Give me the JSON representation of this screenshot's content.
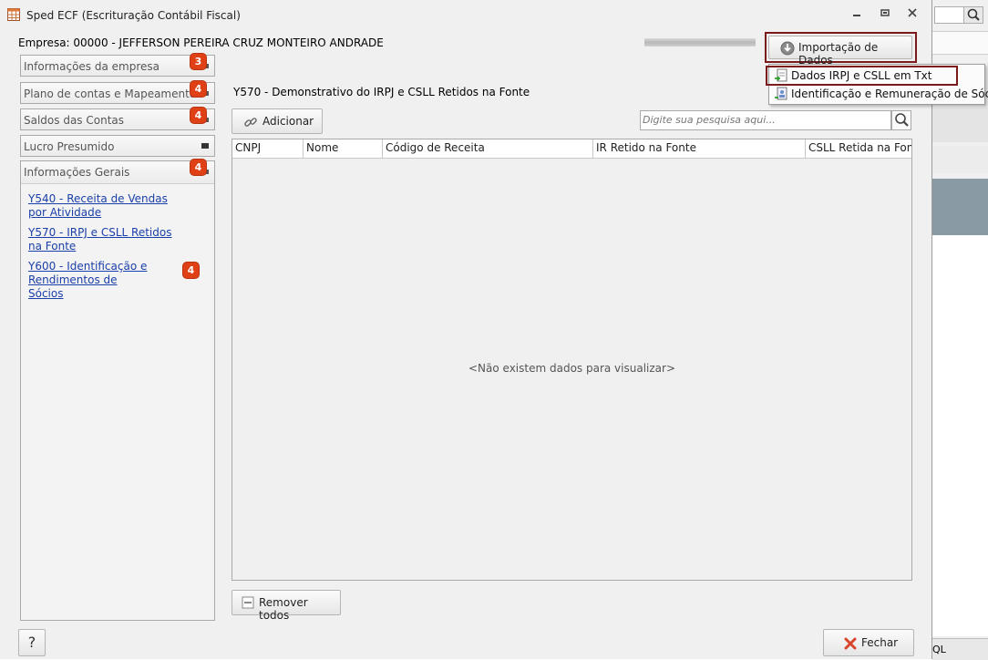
{
  "window": {
    "title": "Sped ECF (Escrituração Contábil Fiscal)",
    "controls": [
      "minimize-icon",
      "restore-icon",
      "close-icon"
    ]
  },
  "empresa": "Empresa: 00000 - JEFFERSON PEREIRA CRUZ MONTEIRO ANDRADE",
  "sidebar": {
    "sections": [
      {
        "label": "Informações da empresa",
        "badge": "3"
      },
      {
        "label": "Plano de contas e Mapeamento",
        "badge": "4"
      },
      {
        "label": "Saldos das Contas",
        "badge": "4"
      },
      {
        "label": "Lucro Presumido",
        "badge": ""
      },
      {
        "label": "Informações Gerais",
        "badge": "4"
      }
    ],
    "links": [
      {
        "text": "Y540 - Receita de Vendas por Atividade",
        "badge": ""
      },
      {
        "text": "Y570 - IRPJ e CSLL Retidos na Fonte",
        "badge": ""
      },
      {
        "text": "Y600 - Identificação e Rendimentos de Sócios",
        "badge": "4"
      }
    ]
  },
  "main": {
    "title": "Y570 - Demonstrativo do IRPJ e CSLL Retidos na Fonte",
    "add_label": "Adicionar",
    "search_placeholder": "Digite sua pesquisa aqui...",
    "columns": [
      "CNPJ",
      "Nome",
      "Código de Receita",
      "IR Retido na Fonte",
      "CSLL Retida na Fonte"
    ],
    "empty_message": "<Não existem dados para visualizar>",
    "remove_all_label": "Remover todos",
    "help_label": "?",
    "close_label": "Fechar"
  },
  "import": {
    "button_label": "Importação de Dados",
    "menu": [
      "Dados IRPJ e CSLL em Txt",
      "Identificação e Remuneração de Sócios"
    ]
  },
  "background": {
    "bottom_text": "QL"
  },
  "colors": {
    "badge": "#e04016",
    "highlight_frame": "#7b1a1a",
    "link": "#1a3fa8",
    "close_icon": "#d9452a"
  }
}
